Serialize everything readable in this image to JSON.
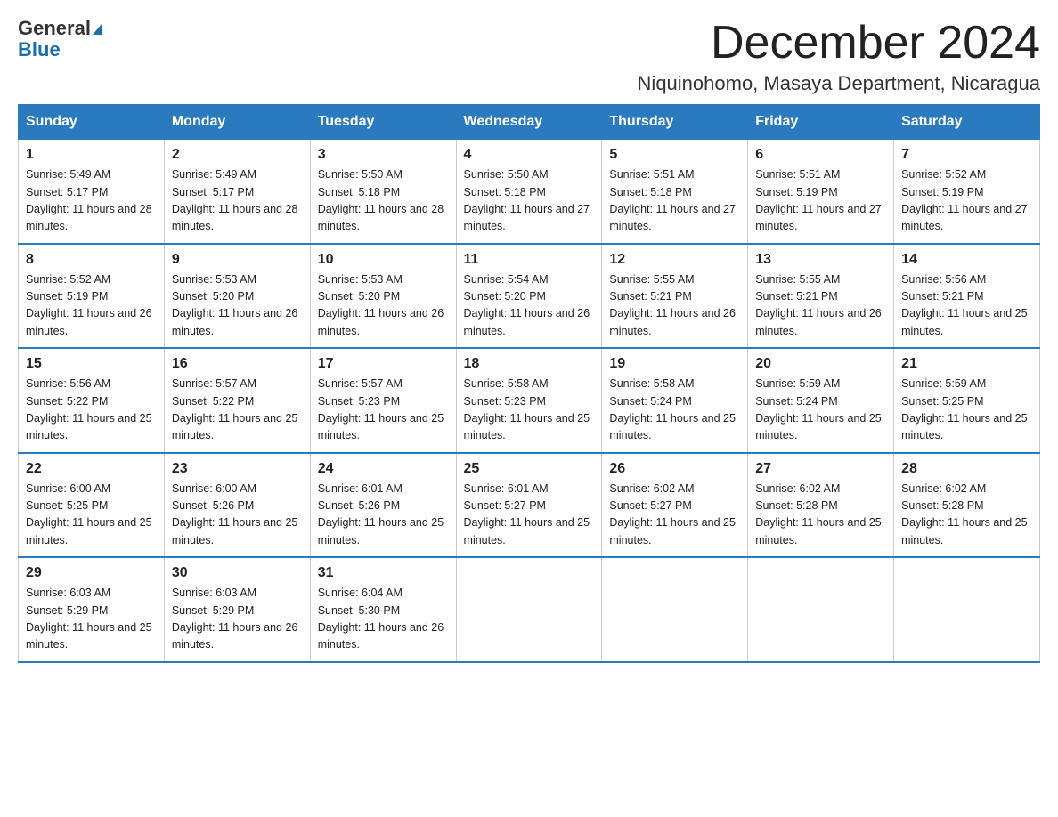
{
  "header": {
    "logo_line1": "General",
    "logo_line2": "Blue",
    "month_title": "December 2024",
    "location": "Niquinohomo, Masaya Department, Nicaragua"
  },
  "weekdays": [
    "Sunday",
    "Monday",
    "Tuesday",
    "Wednesday",
    "Thursday",
    "Friday",
    "Saturday"
  ],
  "weeks": [
    [
      {
        "day": "1",
        "sunrise": "5:49 AM",
        "sunset": "5:17 PM",
        "daylight": "11 hours and 28 minutes."
      },
      {
        "day": "2",
        "sunrise": "5:49 AM",
        "sunset": "5:17 PM",
        "daylight": "11 hours and 28 minutes."
      },
      {
        "day": "3",
        "sunrise": "5:50 AM",
        "sunset": "5:18 PM",
        "daylight": "11 hours and 28 minutes."
      },
      {
        "day": "4",
        "sunrise": "5:50 AM",
        "sunset": "5:18 PM",
        "daylight": "11 hours and 27 minutes."
      },
      {
        "day": "5",
        "sunrise": "5:51 AM",
        "sunset": "5:18 PM",
        "daylight": "11 hours and 27 minutes."
      },
      {
        "day": "6",
        "sunrise": "5:51 AM",
        "sunset": "5:19 PM",
        "daylight": "11 hours and 27 minutes."
      },
      {
        "day": "7",
        "sunrise": "5:52 AM",
        "sunset": "5:19 PM",
        "daylight": "11 hours and 27 minutes."
      }
    ],
    [
      {
        "day": "8",
        "sunrise": "5:52 AM",
        "sunset": "5:19 PM",
        "daylight": "11 hours and 26 minutes."
      },
      {
        "day": "9",
        "sunrise": "5:53 AM",
        "sunset": "5:20 PM",
        "daylight": "11 hours and 26 minutes."
      },
      {
        "day": "10",
        "sunrise": "5:53 AM",
        "sunset": "5:20 PM",
        "daylight": "11 hours and 26 minutes."
      },
      {
        "day": "11",
        "sunrise": "5:54 AM",
        "sunset": "5:20 PM",
        "daylight": "11 hours and 26 minutes."
      },
      {
        "day": "12",
        "sunrise": "5:55 AM",
        "sunset": "5:21 PM",
        "daylight": "11 hours and 26 minutes."
      },
      {
        "day": "13",
        "sunrise": "5:55 AM",
        "sunset": "5:21 PM",
        "daylight": "11 hours and 26 minutes."
      },
      {
        "day": "14",
        "sunrise": "5:56 AM",
        "sunset": "5:21 PM",
        "daylight": "11 hours and 25 minutes."
      }
    ],
    [
      {
        "day": "15",
        "sunrise": "5:56 AM",
        "sunset": "5:22 PM",
        "daylight": "11 hours and 25 minutes."
      },
      {
        "day": "16",
        "sunrise": "5:57 AM",
        "sunset": "5:22 PM",
        "daylight": "11 hours and 25 minutes."
      },
      {
        "day": "17",
        "sunrise": "5:57 AM",
        "sunset": "5:23 PM",
        "daylight": "11 hours and 25 minutes."
      },
      {
        "day": "18",
        "sunrise": "5:58 AM",
        "sunset": "5:23 PM",
        "daylight": "11 hours and 25 minutes."
      },
      {
        "day": "19",
        "sunrise": "5:58 AM",
        "sunset": "5:24 PM",
        "daylight": "11 hours and 25 minutes."
      },
      {
        "day": "20",
        "sunrise": "5:59 AM",
        "sunset": "5:24 PM",
        "daylight": "11 hours and 25 minutes."
      },
      {
        "day": "21",
        "sunrise": "5:59 AM",
        "sunset": "5:25 PM",
        "daylight": "11 hours and 25 minutes."
      }
    ],
    [
      {
        "day": "22",
        "sunrise": "6:00 AM",
        "sunset": "5:25 PM",
        "daylight": "11 hours and 25 minutes."
      },
      {
        "day": "23",
        "sunrise": "6:00 AM",
        "sunset": "5:26 PM",
        "daylight": "11 hours and 25 minutes."
      },
      {
        "day": "24",
        "sunrise": "6:01 AM",
        "sunset": "5:26 PM",
        "daylight": "11 hours and 25 minutes."
      },
      {
        "day": "25",
        "sunrise": "6:01 AM",
        "sunset": "5:27 PM",
        "daylight": "11 hours and 25 minutes."
      },
      {
        "day": "26",
        "sunrise": "6:02 AM",
        "sunset": "5:27 PM",
        "daylight": "11 hours and 25 minutes."
      },
      {
        "day": "27",
        "sunrise": "6:02 AM",
        "sunset": "5:28 PM",
        "daylight": "11 hours and 25 minutes."
      },
      {
        "day": "28",
        "sunrise": "6:02 AM",
        "sunset": "5:28 PM",
        "daylight": "11 hours and 25 minutes."
      }
    ],
    [
      {
        "day": "29",
        "sunrise": "6:03 AM",
        "sunset": "5:29 PM",
        "daylight": "11 hours and 25 minutes."
      },
      {
        "day": "30",
        "sunrise": "6:03 AM",
        "sunset": "5:29 PM",
        "daylight": "11 hours and 26 minutes."
      },
      {
        "day": "31",
        "sunrise": "6:04 AM",
        "sunset": "5:30 PM",
        "daylight": "11 hours and 26 minutes."
      },
      null,
      null,
      null,
      null
    ]
  ]
}
